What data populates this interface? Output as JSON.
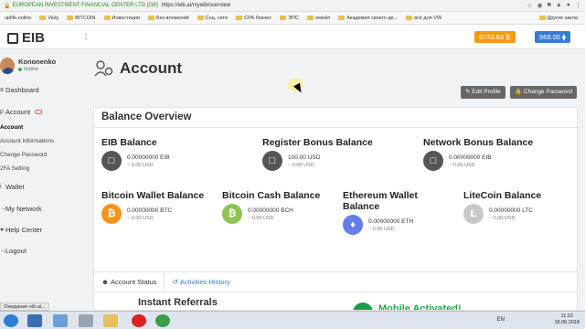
{
  "browser": {
    "secure_label": "EUROPEAN INVESTMENT FINANCIAL CENTER LTD [GB]",
    "url": "https://eib.ai/myeib/overview",
    "bookmarks": [
      "uplife.online",
      "Viuly",
      "BITCOIN",
      "Инвестиции",
      "Без вложений",
      "Соц. сети",
      "СРА бизнес",
      "ЭПС",
      "емейл",
      "Академия своего де...",
      "всё для VW"
    ],
    "other_bookmarks": "Другие закла"
  },
  "header": {
    "logo": "EIB",
    "btc_balance": "6743.83 ₿",
    "eth_balance": "569.00 ⧫"
  },
  "sidebar": {
    "user_name": "Kononenko",
    "user_status": "Online",
    "items": {
      "dashboard": "Dashboard",
      "account": "Account",
      "sub_account": "Account",
      "sub_info": "Account Informations",
      "sub_pass": "Change Password",
      "sub_2fa": "2FA Setting",
      "wallet": "Wallet",
      "network": "My Network",
      "help": "Help Center",
      "logout": "Logout"
    }
  },
  "main": {
    "title": "Account",
    "edit_profile": "Edit Profile",
    "change_password": "Change Password",
    "overview_title": "Balance Overview",
    "balances": {
      "eib": {
        "title": "EIB Balance",
        "amount": "0.00000000 EIB",
        "usd": "~ 0.00 USD"
      },
      "register": {
        "title": "Register Bonus Balance",
        "amount": "100.00 USD",
        "usd": "~ 0.00 USD"
      },
      "network": {
        "title": "Network Bonus Balance",
        "amount": "0.00000000 EIB",
        "usd": "~ 0.00 USD"
      },
      "btc": {
        "title": "Bitcoin Wallet Balance",
        "amount": "0.00000000 BTC",
        "usd": "~ 0.00 USD"
      },
      "bch": {
        "title": "Bitcoin Cash Balance",
        "amount": "0.00000000 BCH",
        "usd": "~ 0.00 USD"
      },
      "eth": {
        "title": "Ethereum Wallet Balance",
        "amount": "0.00000000 ETH",
        "usd": "~ 0.00 USD"
      },
      "ltc": {
        "title": "LiteCoin Balance",
        "amount": "0.00000000 LTC",
        "usd": "~ 0.00 USD"
      }
    },
    "tabs": {
      "status": "Account Status",
      "history": "Activities History"
    },
    "referrals": "Instant Referrals",
    "mobile": "Mobile Activated!"
  },
  "status_url": "Ожидание eib.ai...",
  "taskbar": {
    "lang": "EN",
    "time": "11:22",
    "date": "18.06.2018"
  }
}
